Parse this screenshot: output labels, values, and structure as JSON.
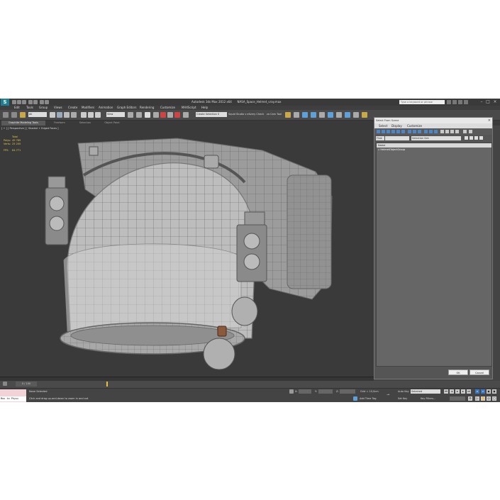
{
  "app": {
    "title": "Autodesk 3ds Max 2012 x64",
    "file": "NASA_Space_Helmet_vray.max",
    "search_placeholder": "Type a keyword or phrase",
    "logo_text": "S"
  },
  "menu": [
    "Edit",
    "Tools",
    "Group",
    "Views",
    "Create",
    "Modifiers",
    "Animation",
    "Graph Editors",
    "Rendering",
    "Customize",
    "MAXScript",
    "Help"
  ],
  "toolbar": {
    "filter": "All",
    "view": "View",
    "selection_set": "Create Selection S",
    "studio_check": "Squid Studio v elivery Check",
    "cam_tool": "zo Cam Tool"
  },
  "ribbon": {
    "tabs": [
      "Graphite Modeling Tools",
      "Freeform",
      "Selection",
      "Object Paint"
    ],
    "active": 0
  },
  "viewport": {
    "label": "[ + ] [ Perspective ] [ Shaded + Edged Faces ]",
    "stats": {
      "total_label": "Total",
      "polys_label": "Polys:",
      "polys": "49 789",
      "verts_label": "Verts:",
      "verts": "25 205",
      "fps_label": "FPS:",
      "fps": "64.771"
    }
  },
  "dialog": {
    "title": "Select From Scene",
    "menu": [
      "Select",
      "Display",
      "Customize"
    ],
    "find_label": "Find:",
    "selection_set_label": "Selection Set:",
    "column_name": "Name",
    "items": [
      "HelmetObjectGroup"
    ],
    "ok": "OK",
    "cancel": "Cancel"
  },
  "timeline": {
    "frame": "0 / 100"
  },
  "status": {
    "maxscript": "Max to Physc",
    "selected": "None Selected",
    "prompt": "Click and drag up-and-down to zoom in and out",
    "x_label": "X:",
    "y_label": "Y:",
    "z_label": "Z:",
    "grid": "Grid = 10,0cm",
    "add_time_tag": "Add Time Tag",
    "auto_key": "Auto Key",
    "set_key": "Set Key",
    "selected_dd": "Selected",
    "key_filters": "Key Filters..."
  },
  "colors": {
    "viewport_bg": "#3a3a3a",
    "mesh": "#9a9a9a",
    "stats": "#e6c84a",
    "accent": "#3b77c2"
  }
}
